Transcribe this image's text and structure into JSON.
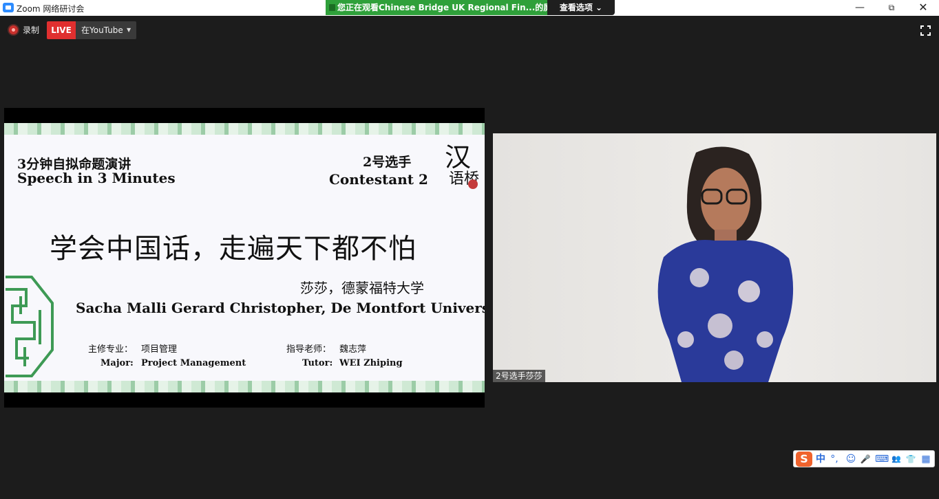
{
  "window": {
    "app_title": "Zoom 网络研讨会",
    "share_status": "您正在观看Chinese Bridge UK Regional Fin...的屏幕",
    "view_options": "查看选项 ⌄",
    "minimize": "—",
    "restore": "⧉",
    "close": "✕"
  },
  "toolbar": {
    "record_label": "录制",
    "live_badge": "LIVE",
    "live_target": "在YouTube",
    "live_caret": "▼"
  },
  "slide": {
    "category_cn": "3分钟自拟命题演讲",
    "category_en": "Speech in 3 Minutes",
    "contestant_cn": "2号选手",
    "contestant_en": "Contestant 2",
    "logo_big": "汉",
    "logo_small": "语桥",
    "headline": "学会中国话，走遍天下都不怕",
    "speaker_cn": "莎莎，德蒙福特大学",
    "speaker_en": "Sacha Malli Gerard Christopher, De Montfort University",
    "major_label_cn": "主修专业：",
    "major_value_cn": "项目管理",
    "major_label_en": "Major:",
    "major_value_en": "Project Management",
    "tutor_label_cn": "指导老师：",
    "tutor_value_cn": "魏志萍",
    "tutor_label_en": "Tutor:",
    "tutor_value_en": "WEI Zhiping"
  },
  "video": {
    "participant_name": "2号选手莎莎"
  },
  "ime": {
    "logo": "S",
    "items": [
      "中",
      "°,",
      "☺",
      "🎤",
      "⌨",
      "👥",
      "👕",
      "▦"
    ]
  },
  "colors": {
    "live_red": "#e02f2f",
    "share_green": "#2fa03a",
    "slide_green": "#9ccca7",
    "ime_orange": "#f0632d"
  }
}
